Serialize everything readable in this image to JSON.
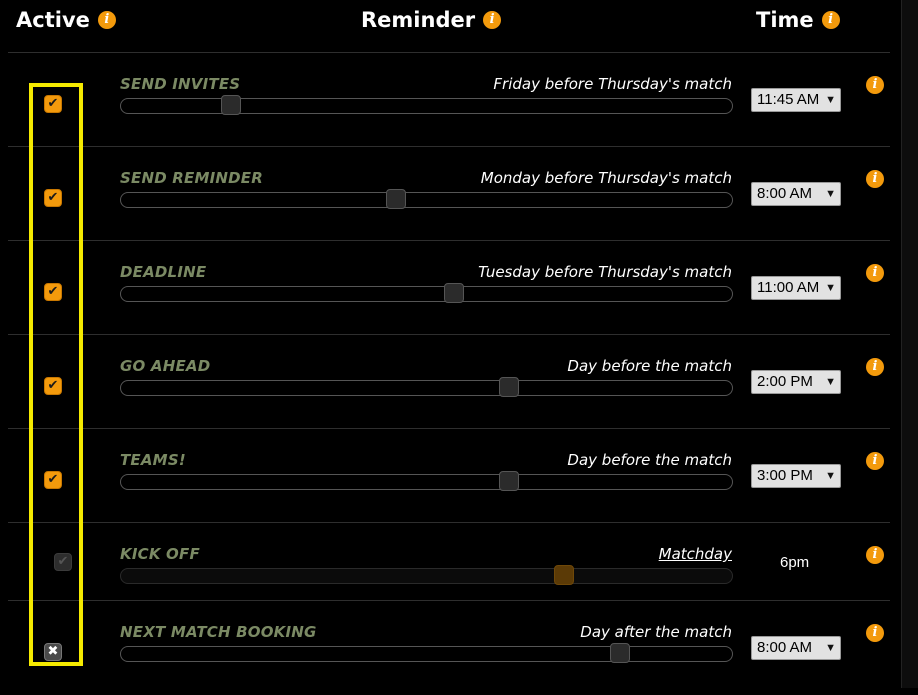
{
  "header": {
    "active": "Active",
    "reminder": "Reminder",
    "time": "Time"
  },
  "accent_color": "#f39a0c",
  "highlight_color": "#f5ea00",
  "rows": [
    {
      "label": "SEND INVITES",
      "desc": "Friday before Thursday's match",
      "time": "11:45 AM",
      "checked": true,
      "slider": 0.18
    },
    {
      "label": "SEND REMINDER",
      "desc": "Monday before Thursday's match",
      "time": "8:00 AM",
      "checked": true,
      "slider": 0.45
    },
    {
      "label": "DEADLINE",
      "desc": "Tuesday before Thursday's match",
      "time": "11:00 AM",
      "checked": true,
      "slider": 0.545
    },
    {
      "label": "GO AHEAD",
      "desc": "Day before the match",
      "time": "2:00 PM",
      "checked": true,
      "slider": 0.635
    },
    {
      "label": "TEAMS!",
      "desc": "Day before the match",
      "time": "3:00 PM",
      "checked": true,
      "slider": 0.635
    },
    {
      "label": "KICK OFF",
      "desc": "Matchday",
      "time": "6pm",
      "checked": true,
      "disabled": true,
      "slider": 0.725
    },
    {
      "label": "NEXT MATCH BOOKING",
      "desc": "Day after the match",
      "time": "8:00 AM",
      "checked": false,
      "slider": 0.816
    }
  ]
}
